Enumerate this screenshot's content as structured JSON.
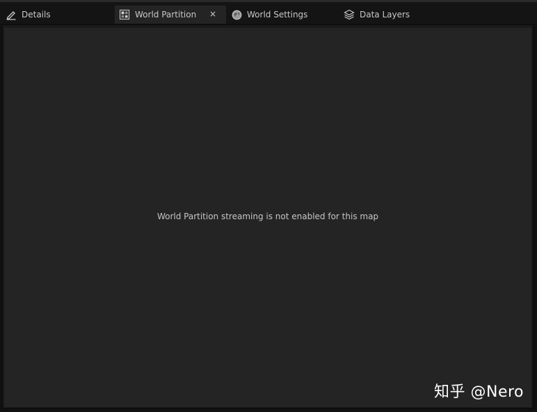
{
  "tabs": [
    {
      "label": "Details",
      "icon": "pencil-icon",
      "active": false
    },
    {
      "label": "World Partition",
      "icon": "world-partition-icon",
      "active": true,
      "close_symbol": "×"
    },
    {
      "label": "World Settings",
      "icon": "globe-icon",
      "active": false
    },
    {
      "label": "Data Layers",
      "icon": "layers-icon",
      "active": false
    }
  ],
  "panel": {
    "message": "World Partition streaming is not enabled for this map"
  },
  "watermark": "知乎 @Nero",
  "colors": {
    "tab_bar_bg": "#141414",
    "active_tab_bg": "#242424",
    "panel_bg": "#242424",
    "text": "#c8c8c8"
  }
}
